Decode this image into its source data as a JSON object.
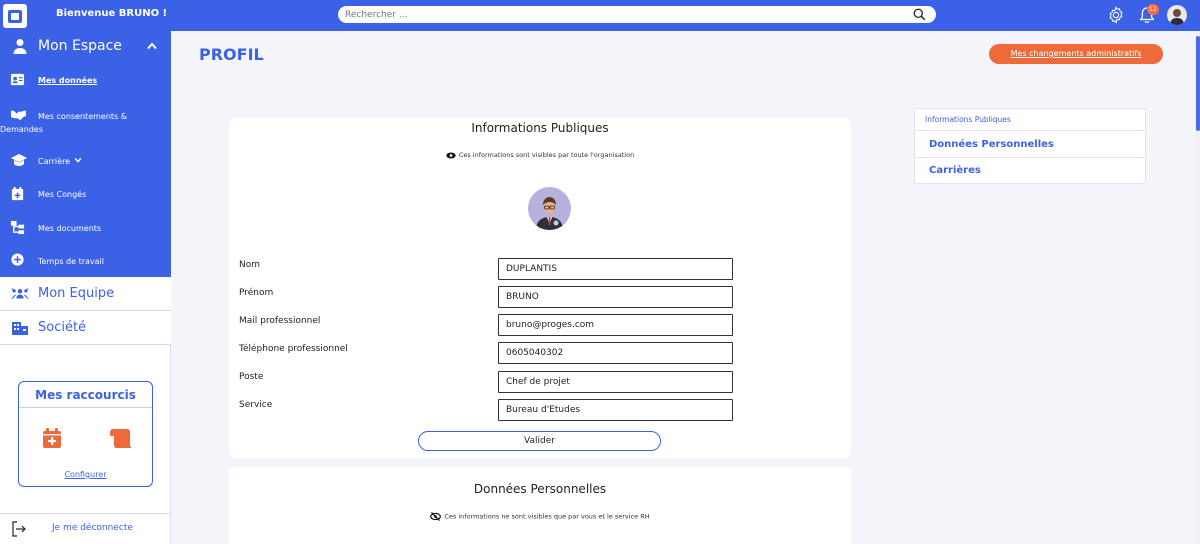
{
  "header": {
    "welcome": "Bienvenue BRUNO !",
    "search_placeholder": "Rechercher ...",
    "notifications_count": "12"
  },
  "sidebar": {
    "section_title": "Mon Espace",
    "items": [
      {
        "label": "Mes données",
        "active": true,
        "icon": "id-card-icon"
      },
      {
        "label": "Mes consentements &",
        "label2": "Demandes",
        "icon": "handshake-icon"
      },
      {
        "label": "Carrière",
        "icon": "graduation-cap-icon"
      },
      {
        "label": "Mes Congés",
        "icon": "calendar-plus-icon"
      },
      {
        "label": "Mes documents",
        "icon": "sitemap-icon"
      },
      {
        "label": "Temps de travail",
        "icon": "plus-circle-icon"
      }
    ],
    "nav": [
      {
        "label": "Mon Equipe",
        "icon": "team-icon"
      },
      {
        "label": "Société",
        "icon": "building-icon"
      }
    ],
    "shortcuts": {
      "title": "Mes raccourcis",
      "configure": "Configurer"
    },
    "logout": "Je me déconnecte"
  },
  "main": {
    "page_title": "PROFIL",
    "admin_button": "Mes changements administratifs",
    "public_card": {
      "title": "Informations Publiques",
      "note": "Ces informations sont visibles par toute l'organisation",
      "fields": [
        {
          "label": "Nom",
          "value": "DUPLANTIS"
        },
        {
          "label": "Prénom",
          "value": "BRUNO"
        },
        {
          "label": "Mail professionnel",
          "value": "bruno@proges.com"
        },
        {
          "label": "Téléphone professionnel",
          "value": "0605040302"
        },
        {
          "label": "Poste",
          "value": "Chef de projet"
        },
        {
          "label": "Service",
          "value": "Bureau d'Etudes"
        }
      ],
      "submit": "Valider"
    },
    "personal_card": {
      "title": "Données Personnelles",
      "note": "Ces informations ne sont visibles que par vous et le service RH"
    }
  },
  "right_nav": {
    "items": [
      "Informations Publiques",
      "Données Personnelles",
      "Carrières"
    ]
  },
  "colors": {
    "primary": "#3b62e6",
    "accent": "#ee6a3a"
  }
}
